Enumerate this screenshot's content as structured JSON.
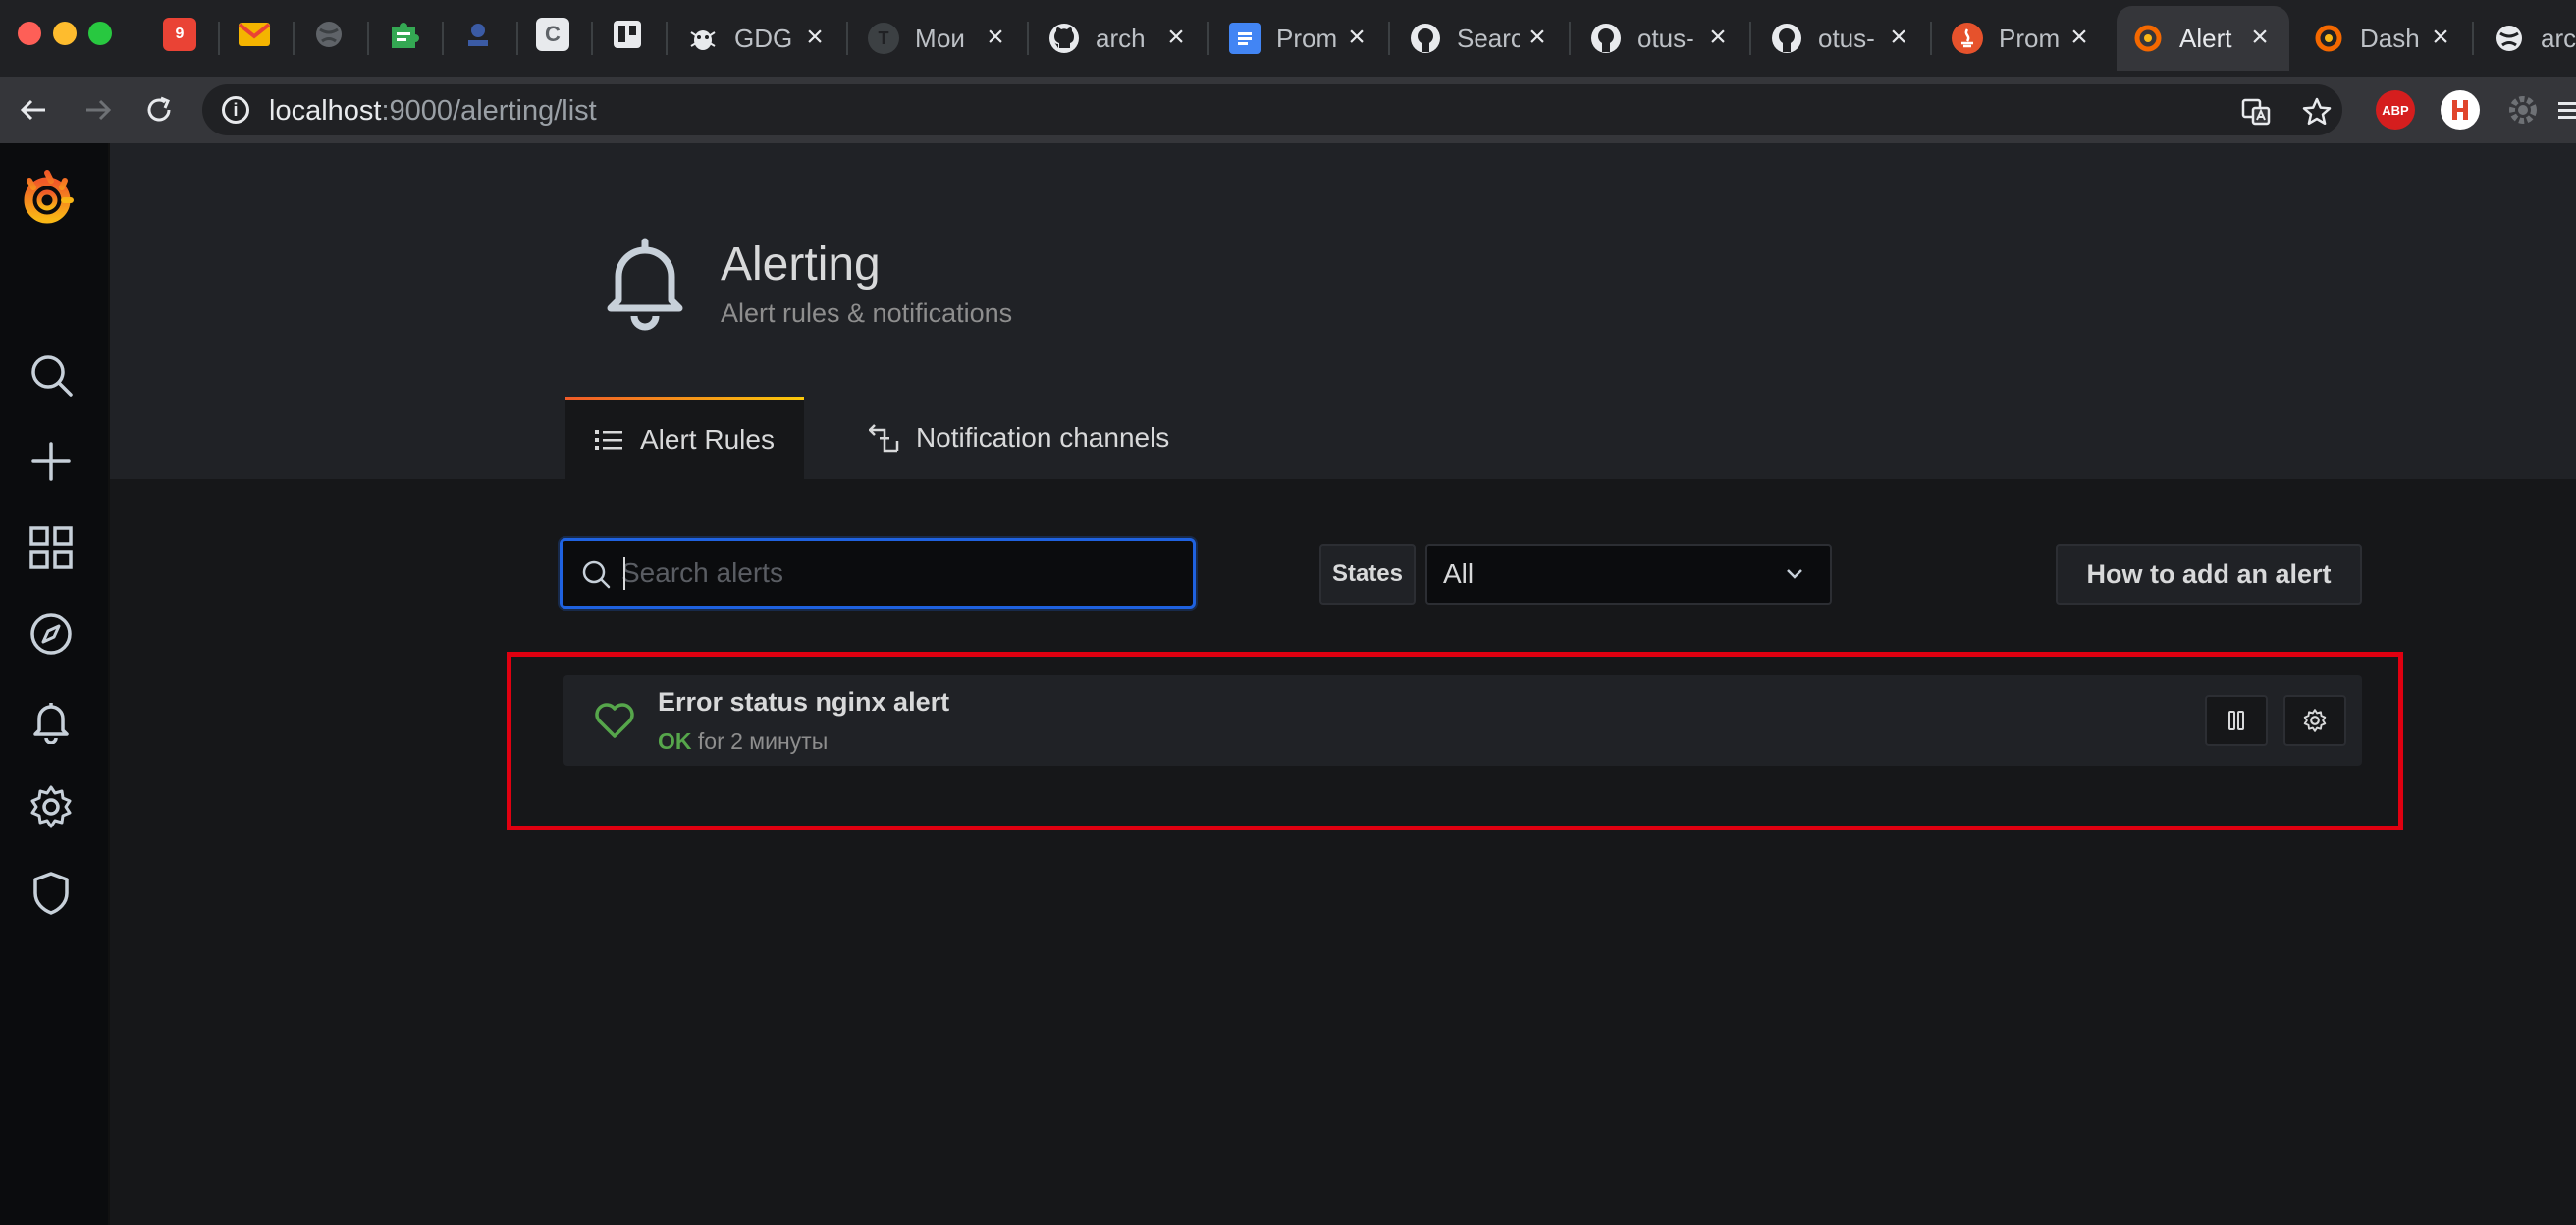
{
  "browser": {
    "tabs": [
      {
        "label": "GDG",
        "icon": "bug-icon"
      },
      {
        "label": "Мои",
        "icon": "t-logo-icon"
      },
      {
        "label": "arch",
        "icon": "github-icon"
      },
      {
        "label": "Prom",
        "icon": "docs-icon"
      },
      {
        "label": "Searc",
        "icon": "github-icon"
      },
      {
        "label": "otus-",
        "icon": "github-icon"
      },
      {
        "label": "otus-",
        "icon": "github-icon"
      },
      {
        "label": "Prom",
        "icon": "prometheus-icon"
      },
      {
        "label": "Alert",
        "icon": "grafana-icon",
        "active": true
      },
      {
        "label": "Dash",
        "icon": "grafana-icon"
      },
      {
        "label": "arcl",
        "icon": "globe-icon"
      }
    ],
    "pinned": {
      "calendar_day": "9",
      "c_letter": "C"
    },
    "address": {
      "host": "localhost",
      "rest": ":9000/alerting/list"
    },
    "extensions": {
      "abp": "ABP"
    }
  },
  "header": {
    "title": "Alerting",
    "subtitle": "Alert rules & notifications",
    "tabs": [
      {
        "label": "Alert Rules",
        "active": true
      },
      {
        "label": "Notification channels"
      }
    ]
  },
  "filters": {
    "search_placeholder": "Search alerts",
    "states_label": "States",
    "states_value": "All",
    "howto_label": "How to add an alert"
  },
  "alerts": [
    {
      "name": "Error status nginx alert",
      "state": "OK",
      "duration": "for 2 минуты"
    }
  ],
  "colors": {
    "ok": "#56a64b",
    "highlight": "#e00010",
    "focus": "#1f62e0"
  }
}
